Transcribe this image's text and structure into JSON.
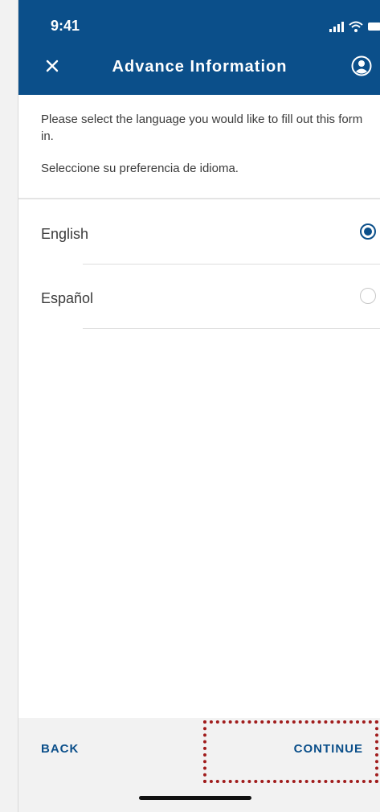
{
  "status_bar": {
    "time": "9:41",
    "icons": [
      "signal-icon",
      "wifi-icon",
      "battery-icon"
    ]
  },
  "nav": {
    "title": "Advance Information",
    "close_icon": "close-icon",
    "profile_icon": "user-circle-icon"
  },
  "intro": {
    "english": "Please select the language you would like to fill out this form in.",
    "spanish": "Seleccione su preferencia de idioma."
  },
  "language_options": [
    {
      "label": "English",
      "selected": true
    },
    {
      "label": "Español",
      "selected": false
    }
  ],
  "footer": {
    "back_label": "BACK",
    "continue_label": "CONTINUE"
  },
  "colors": {
    "brand": "#0b4f8a",
    "highlight": "#a01c1c",
    "text": "#3b3b3b",
    "footer_bg": "#f2f2f2"
  }
}
